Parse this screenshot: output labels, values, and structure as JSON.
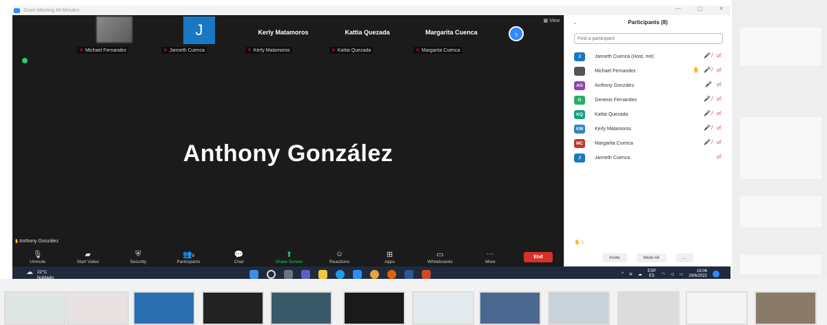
{
  "window": {
    "title": "Zoom Meeting 40-Minutes"
  },
  "view_label": "View",
  "top_tiles": [
    {
      "name": "",
      "label": "Michael Fernandez",
      "kind": "blurred"
    },
    {
      "name": "",
      "label": "Janneth Cuenca",
      "kind": "initial",
      "initial": "J"
    },
    {
      "name": "Kerly Matamoros",
      "label": "Kerly Matamoros",
      "kind": "name"
    },
    {
      "name": "Kattia Quezada",
      "label": "Kattia Quezada",
      "kind": "name"
    },
    {
      "name": "Margarita Cuenca",
      "label": "Margarita Cuenca",
      "kind": "name"
    }
  ],
  "active_speaker": {
    "name": "Anthony González",
    "label": "Anthony González"
  },
  "toolbar": {
    "unmute": "Unmute",
    "start_video": "Start Video",
    "security": "Security",
    "participants": "Participants",
    "participants_count": "8",
    "chat": "Chat",
    "share_screen": "Share Screen",
    "reactions": "Reactions",
    "apps": "Apps",
    "whiteboards": "Whiteboards",
    "more": "More",
    "end": "End"
  },
  "panel": {
    "title": "Participants (8)",
    "search_placeholder": "Find a participant",
    "participants": [
      {
        "name": "Janneth Cuenca (Host, me)",
        "initials": "J",
        "color": "#1a78c2"
      },
      {
        "name": "Michael Fernandez",
        "initials": "",
        "color": "#555555"
      },
      {
        "name": "Anthony González",
        "initials": "AG",
        "color": "#8e44ad"
      },
      {
        "name": "Genesis Fernandez",
        "initials": "G",
        "color": "#27ae60"
      },
      {
        "name": "Kattia Quezada",
        "initials": "KQ",
        "color": "#16a085"
      },
      {
        "name": "Kerly Matamoros",
        "initials": "KM",
        "color": "#2e86c1"
      },
      {
        "name": "Margarita Cuenca",
        "initials": "MC",
        "color": "#c0392b"
      },
      {
        "name": "Janneth Cuenca",
        "initials": "J",
        "color": "#1a78c2"
      }
    ],
    "raised_hands": "1",
    "invite": "Invite",
    "mute_all": "Mute All",
    "more": "..."
  },
  "taskbar": {
    "temperature": "22°C",
    "weather": "Nublado",
    "lang_top": "ESP",
    "lang_bottom": "ES",
    "time": "16:06",
    "date": "29/6/2022"
  }
}
